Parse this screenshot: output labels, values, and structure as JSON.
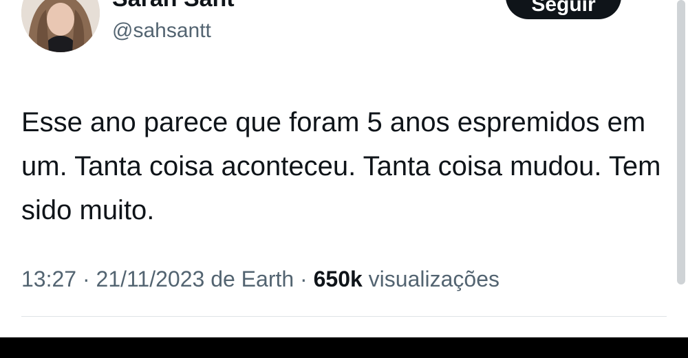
{
  "tweet": {
    "author": {
      "display_name": "Sarah Sant",
      "handle": "@sahsantt",
      "avatar": "profile-photo"
    },
    "follow_label": "Seguir",
    "more_icon": "more-dots-icon",
    "text": "Esse ano parece que foram 5 anos espremidos em um. Tanta coisa aconteceu. Tanta coisa mudou. Tem sido muito.",
    "meta": {
      "time": "13:27",
      "separator": "·",
      "date": "21/11/2023",
      "source": "de Earth",
      "views_count": "650k",
      "views_label": "visualizações"
    }
  },
  "colors": {
    "text_primary": "#0f1419",
    "text_secondary": "#536471",
    "button_bg": "#0f1419",
    "button_text": "#ffffff"
  }
}
